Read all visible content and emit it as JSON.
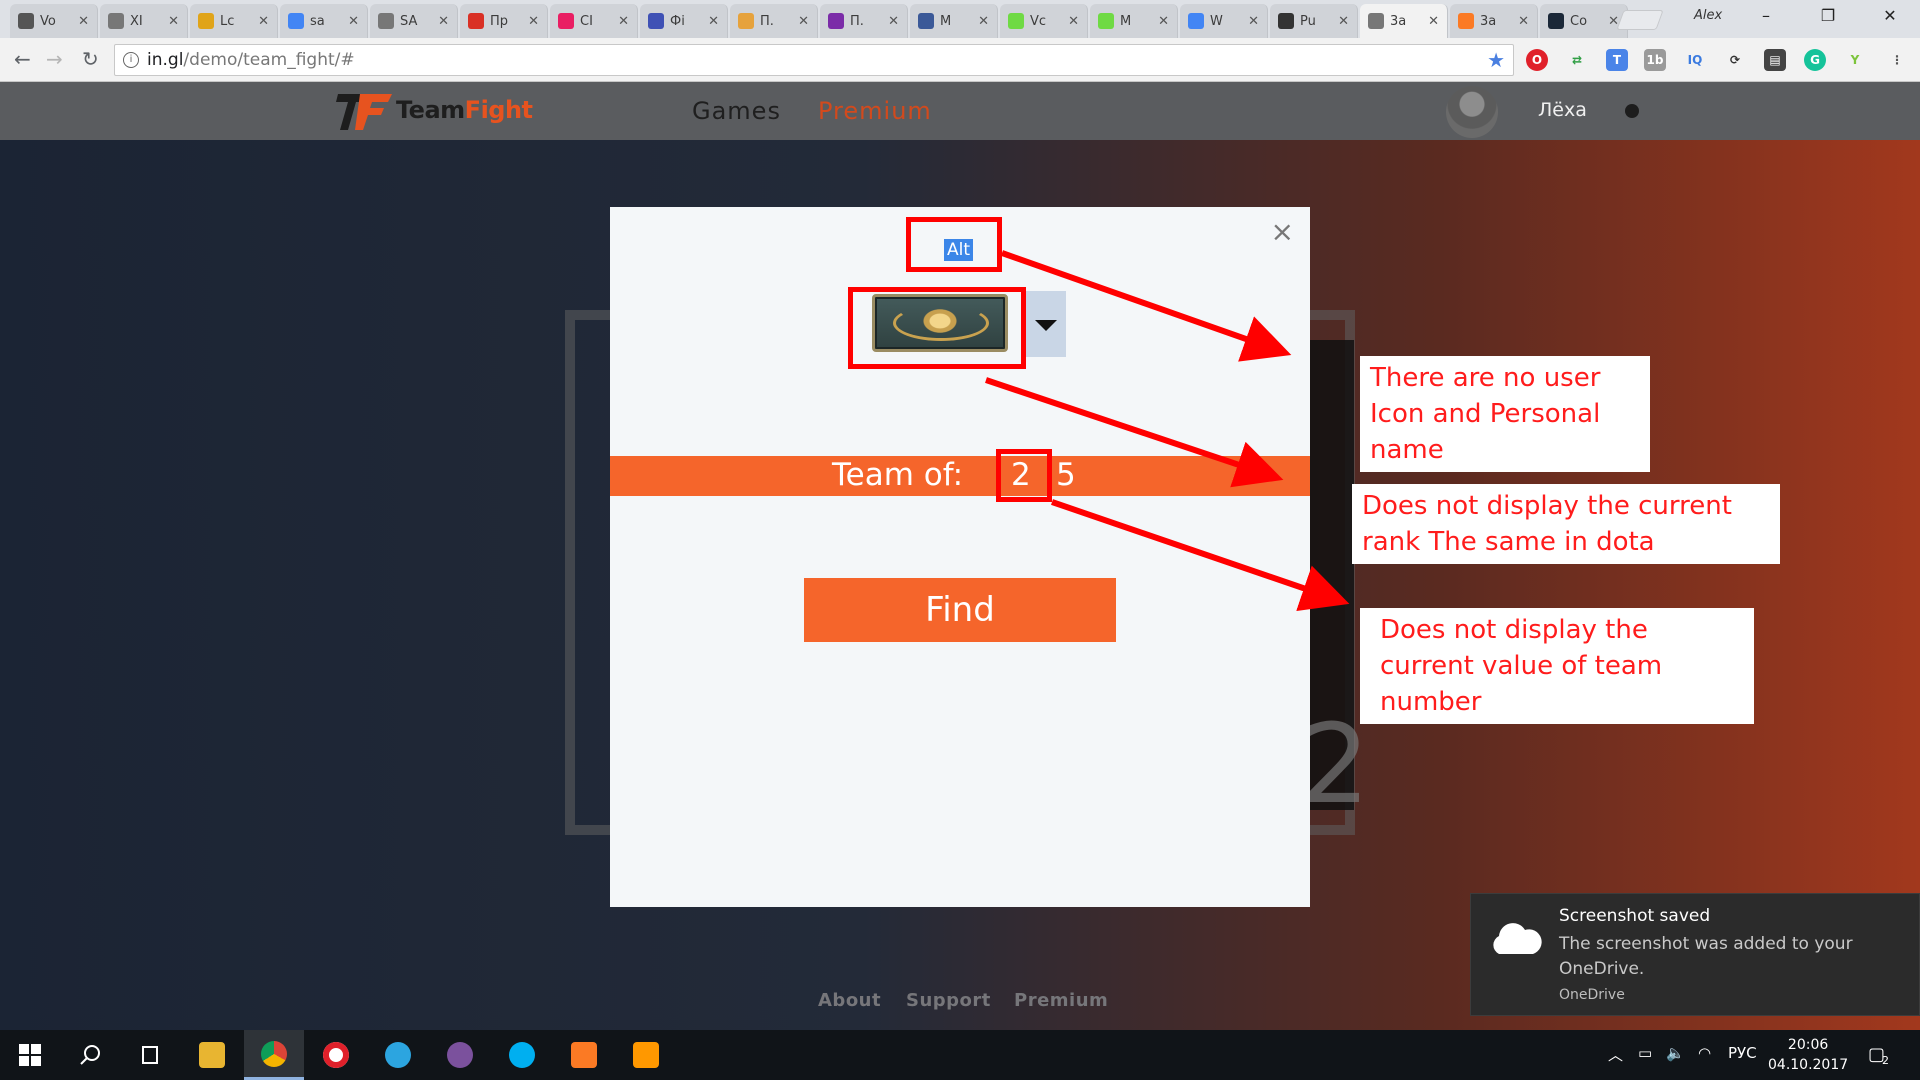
{
  "browser": {
    "tabs": [
      {
        "title": "Vo",
        "favicon": "codepen-icon",
        "color": "#555"
      },
      {
        "title": "XI",
        "favicon": "page-icon",
        "color": "#777"
      },
      {
        "title": "Lc",
        "favicon": "r-icon",
        "color": "#e0a419"
      },
      {
        "title": "sa",
        "favicon": "google-icon",
        "color": "#4285f4"
      },
      {
        "title": "SA",
        "favicon": "page-icon",
        "color": "#777"
      },
      {
        "title": "Пр",
        "favicon": "gmail-icon",
        "color": "#d93025"
      },
      {
        "title": "CI",
        "favicon": "cee-icon",
        "color": "#e91e63"
      },
      {
        "title": "Фі",
        "favicon": "translate-icon",
        "color": "#3f51b5"
      },
      {
        "title": "П.",
        "favicon": "sale-icon",
        "color": "#e6a23c"
      },
      {
        "title": "П.",
        "favicon": "ur-icon",
        "color": "#7b2ca8"
      },
      {
        "title": "M",
        "favicon": "facebook-icon",
        "color": "#3b5998"
      },
      {
        "title": "Vc",
        "favicon": "upwork-icon",
        "color": "#6fda44"
      },
      {
        "title": "M",
        "favicon": "upwork-icon",
        "color": "#6fda44"
      },
      {
        "title": "W",
        "favicon": "google-icon",
        "color": "#4285f4"
      },
      {
        "title": "Pu",
        "favicon": "github-icon",
        "color": "#333"
      },
      {
        "title": "3a",
        "favicon": "page-icon",
        "color": "#777",
        "active": true
      },
      {
        "title": "3a",
        "favicon": "xampp-icon",
        "color": "#fb7a24"
      },
      {
        "title": "Co",
        "favicon": "steam-icon",
        "color": "#1b2838"
      }
    ],
    "profile": "Alex",
    "url_host": "in.gl",
    "url_path": "/demo/team_fight/#",
    "window_controls": {
      "minimize": "–",
      "restore": "❐",
      "close": "✕"
    }
  },
  "site": {
    "logo_team": "Team",
    "logo_fight": "Fight",
    "nav": {
      "games": "Games",
      "premium": "Premium"
    },
    "user_name": "Лёха",
    "footer": {
      "about": "About",
      "support": "Support",
      "premium": "Premium"
    },
    "bg_number": "2"
  },
  "modal": {
    "close": "×",
    "alt_label": "Alt",
    "team_label": "Team of:",
    "team_options": [
      "2",
      "5"
    ],
    "find_label": "Find"
  },
  "annotations": [
    {
      "text": "There are no user Icon and Personal name"
    },
    {
      "text": "Does not display the current rank The same in dota"
    },
    {
      "text": "Does not display the current value of team number"
    }
  ],
  "toast": {
    "title": "Screenshot saved",
    "body": "The screenshot was added to your OneDrive.",
    "source": "OneDrive"
  },
  "taskbar": {
    "lang": "РУС",
    "time": "20:06",
    "date": "04.10.2017",
    "notifications": "2"
  },
  "colors": {
    "accent": "#f5652b",
    "annotation": "#ff0000",
    "premium": "#d24a1d"
  }
}
